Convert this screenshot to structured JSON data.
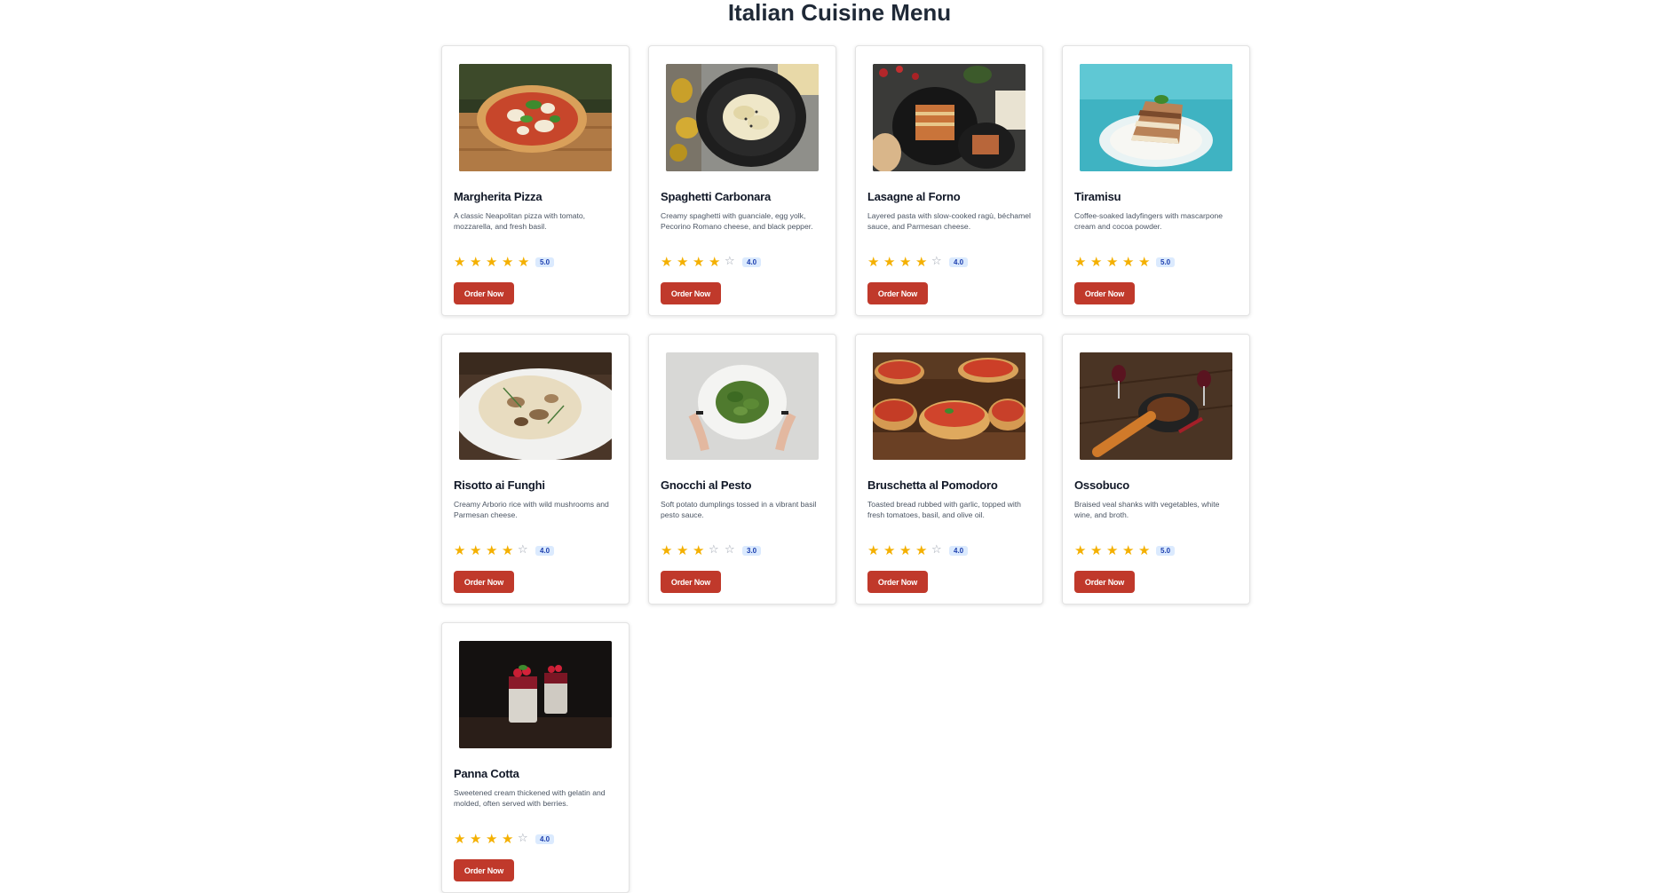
{
  "page": {
    "title": "Italian Cuisine Menu"
  },
  "colors": {
    "accent_button": "#c0392b",
    "star_filled": "#f4b000",
    "star_empty": "#9ca3af",
    "badge_bg": "#dbeafe",
    "badge_text": "#1e40af"
  },
  "dishes": [
    {
      "name": "Margherita Pizza",
      "description": "A classic Neapolitan pizza with tomato, mozzarella, and fresh basil.",
      "rating": 5,
      "rating_label": "5.0",
      "order_label": "Order Now"
    },
    {
      "name": "Spaghetti Carbonara",
      "description": "Creamy spaghetti with guanciale, egg yolk, Pecorino Romano cheese, and black pepper.",
      "rating": 4,
      "rating_label": "4.0",
      "order_label": "Order Now"
    },
    {
      "name": "Lasagne al Forno",
      "description": "Layered pasta with slow-cooked ragù, béchamel sauce, and Parmesan cheese.",
      "rating": 4,
      "rating_label": "4.0",
      "order_label": "Order Now"
    },
    {
      "name": "Tiramisu",
      "description": "Coffee-soaked ladyfingers with mascarpone cream and cocoa powder.",
      "rating": 5,
      "rating_label": "5.0",
      "order_label": "Order Now"
    },
    {
      "name": "Risotto ai Funghi",
      "description": "Creamy Arborio rice with wild mushrooms and Parmesan cheese.",
      "rating": 4,
      "rating_label": "4.0",
      "order_label": "Order Now"
    },
    {
      "name": "Gnocchi al Pesto",
      "description": "Soft potato dumplings tossed in a vibrant basil pesto sauce.",
      "rating": 3,
      "rating_label": "3.0",
      "order_label": "Order Now"
    },
    {
      "name": "Bruschetta al Pomodoro",
      "description": "Toasted bread rubbed with garlic, topped with fresh tomatoes, basil, and olive oil.",
      "rating": 4,
      "rating_label": "4.0",
      "order_label": "Order Now"
    },
    {
      "name": "Ossobuco",
      "description": "Braised veal shanks with vegetables, white wine, and broth.",
      "rating": 5,
      "rating_label": "5.0",
      "order_label": "Order Now"
    },
    {
      "name": "Panna Cotta",
      "description": "Sweetened cream thickened with gelatin and molded, often served with berries.",
      "rating": 4,
      "rating_label": "4.0",
      "order_label": "Order Now"
    }
  ]
}
